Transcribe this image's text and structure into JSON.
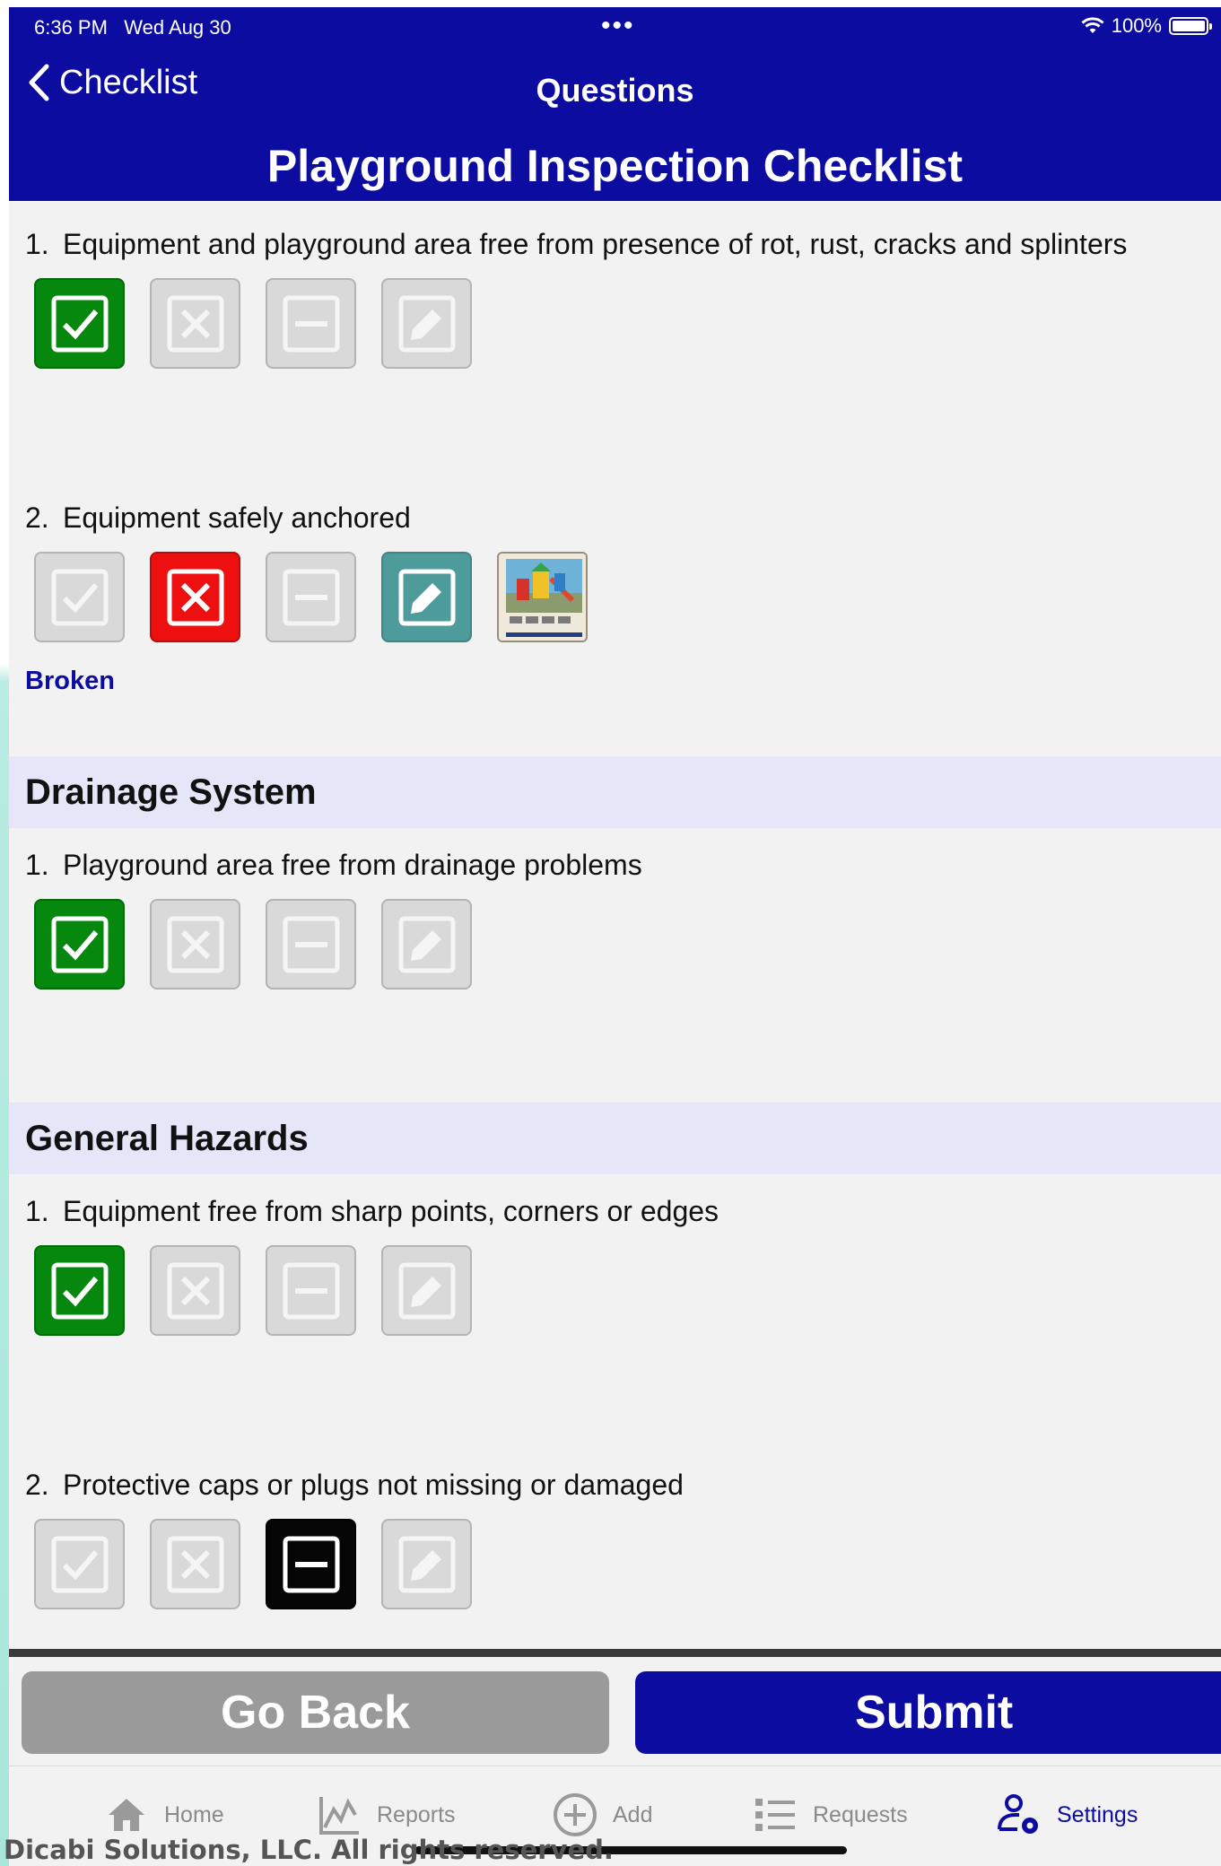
{
  "status_bar": {
    "time": "6:36 PM",
    "date": "Wed Aug 30",
    "battery": "100%",
    "more_icon": "ellipsis-icon",
    "wifi_icon": "wifi-icon",
    "battery_icon": "battery-icon"
  },
  "nav": {
    "back_label": "Checklist",
    "title": "Questions",
    "page_title": "Playground Inspection Checklist"
  },
  "sections": [
    {
      "questions": [
        {
          "number": "1.",
          "text": "Equipment and playground area free from presence of rot, rust, cracks and splinters",
          "selected": "yes"
        },
        {
          "number": "2.",
          "text": "Equipment safely anchored",
          "selected": "no",
          "note_selected": true,
          "note": "Broken",
          "has_photo": true
        }
      ]
    },
    {
      "title": "Drainage System",
      "questions": [
        {
          "number": "1.",
          "text": "Playground area free from drainage problems",
          "selected": "yes"
        }
      ]
    },
    {
      "title": "General Hazards",
      "questions": [
        {
          "number": "1.",
          "text": "Equipment free from sharp points, corners or edges",
          "selected": "yes"
        },
        {
          "number": "2.",
          "text": "Protective caps or plugs not missing or damaged",
          "selected": "na"
        }
      ]
    }
  ],
  "actions": {
    "go_back": "Go Back",
    "submit": "Submit"
  },
  "tabbar": [
    {
      "label": "Home",
      "icon": "home-icon",
      "active": false
    },
    {
      "label": "Reports",
      "icon": "reports-chart-icon",
      "active": false
    },
    {
      "label": "Add",
      "icon": "add-circle-icon",
      "active": false
    },
    {
      "label": "Requests",
      "icon": "list-icon",
      "active": false
    },
    {
      "label": "Settings",
      "icon": "user-settings-icon",
      "active": true
    }
  ],
  "colors": {
    "primary": "#0c0ca0",
    "yes": "#06880e",
    "no": "#ee1010",
    "na": "#050505",
    "note": "#4d9b9b",
    "section_bg": "#e6e6f9"
  },
  "copyright": "Dicabi Solutions, LLC. All rights reserved."
}
